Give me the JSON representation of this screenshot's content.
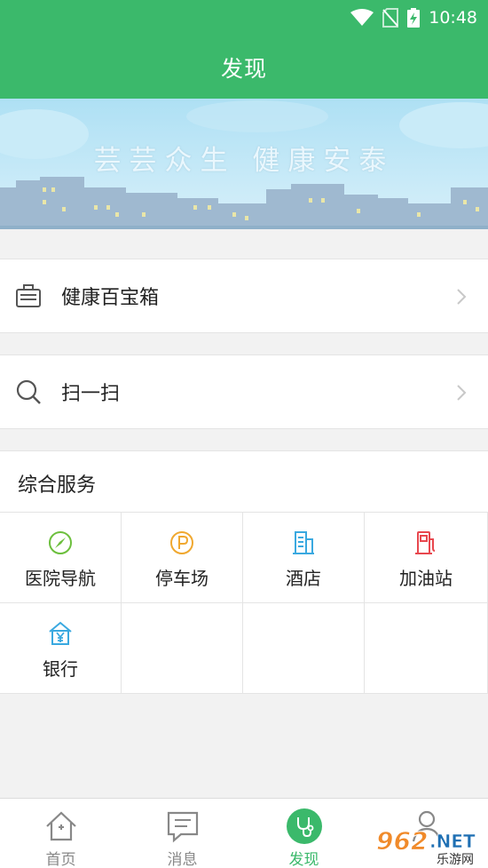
{
  "status_bar": {
    "time": "10:48"
  },
  "header": {
    "title": "发现"
  },
  "banner": {
    "slogan": "芸芸众生  健康安泰"
  },
  "menu": [
    {
      "label": "健康百宝箱",
      "icon": "briefcase-icon"
    },
    {
      "label": "扫一扫",
      "icon": "search-icon"
    }
  ],
  "services": {
    "title": "综合服务",
    "items": [
      {
        "label": "医院导航",
        "icon": "compass-icon",
        "color": "#6cbf3d"
      },
      {
        "label": "停车场",
        "icon": "parking-icon",
        "color": "#f0a830"
      },
      {
        "label": "酒店",
        "icon": "building-icon",
        "color": "#3aa9e0"
      },
      {
        "label": "加油站",
        "icon": "fuel-pump-icon",
        "color": "#e8474e"
      },
      {
        "label": "银行",
        "icon": "bank-icon",
        "color": "#3aa9e0"
      }
    ]
  },
  "tabbar": {
    "items": [
      {
        "label": "首页",
        "icon": "home-icon",
        "active": false
      },
      {
        "label": "消息",
        "icon": "message-icon",
        "active": false
      },
      {
        "label": "发现",
        "icon": "stethoscope-icon",
        "active": true
      },
      {
        "label": "",
        "icon": "profile-icon",
        "active": false
      }
    ]
  },
  "watermark": {
    "number": "962",
    "suffix": ".NET",
    "caption": "乐游网"
  },
  "colors": {
    "brand": "#3bb96b",
    "background": "#f2f2f2",
    "divider": "#e4e4e4"
  }
}
